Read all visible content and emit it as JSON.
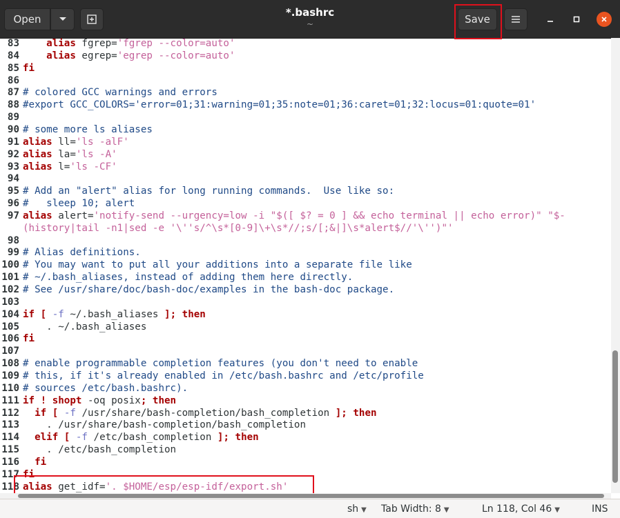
{
  "header": {
    "open_label": "Open",
    "open_dropdown_icon": "chevron-down-icon",
    "new_tab_icon": "new-document-icon",
    "title": "*.bashrc",
    "subtitle": "~",
    "save_label": "Save",
    "menu_icon": "hamburger-menu-icon",
    "minimize_icon": "minimize-icon",
    "maximize_icon": "maximize-icon",
    "close_icon": "close-icon"
  },
  "colors": {
    "keyword": "#a40000",
    "string": "#c4619a",
    "comment": "#204a87",
    "highlight_box": "#e0101c",
    "close_button": "#e95420"
  },
  "editor": {
    "lines": [
      {
        "n": "83",
        "segs": [
          [
            "    ",
            ""
          ],
          [
            "alias",
            "kw"
          ],
          [
            " fgrep=",
            ""
          ],
          [
            "'fgrep --color=auto'",
            "str"
          ]
        ]
      },
      {
        "n": "84",
        "segs": [
          [
            "    ",
            ""
          ],
          [
            "alias",
            "kw"
          ],
          [
            " egrep=",
            ""
          ],
          [
            "'egrep --color=auto'",
            "str"
          ]
        ]
      },
      {
        "n": "85",
        "segs": [
          [
            "fi",
            "kw"
          ]
        ]
      },
      {
        "n": "86",
        "segs": []
      },
      {
        "n": "87",
        "segs": [
          [
            "# colored GCC warnings and errors",
            "cmt"
          ]
        ]
      },
      {
        "n": "88",
        "segs": [
          [
            "#export GCC_COLORS='error=01;31:warning=01;35:note=01;36:caret=01;32:locus=01:quote=01'",
            "cmt"
          ]
        ]
      },
      {
        "n": "89",
        "segs": []
      },
      {
        "n": "90",
        "segs": [
          [
            "# some more ls aliases",
            "cmt"
          ]
        ]
      },
      {
        "n": "91",
        "segs": [
          [
            "alias",
            "kw"
          ],
          [
            " ll=",
            ""
          ],
          [
            "'ls -alF'",
            "str"
          ]
        ]
      },
      {
        "n": "92",
        "segs": [
          [
            "alias",
            "kw"
          ],
          [
            " la=",
            ""
          ],
          [
            "'ls -A'",
            "str"
          ]
        ]
      },
      {
        "n": "93",
        "segs": [
          [
            "alias",
            "kw"
          ],
          [
            " l=",
            ""
          ],
          [
            "'ls -CF'",
            "str"
          ]
        ]
      },
      {
        "n": "94",
        "segs": []
      },
      {
        "n": "95",
        "segs": [
          [
            "# Add an \"alert\" alias for long running commands.  Use like so:",
            "cmt"
          ]
        ]
      },
      {
        "n": "96",
        "segs": [
          [
            "#   sleep 10; alert",
            "cmt"
          ]
        ]
      },
      {
        "n": "97",
        "segs": [
          [
            "alias",
            "kw"
          ],
          [
            " alert=",
            ""
          ],
          [
            "'notify-send --urgency=low -i \"$([ $? = 0 ] && echo terminal || echo error)\" \"$-",
            "str"
          ]
        ]
      },
      {
        "n": "",
        "segs": [
          [
            "(history|tail -n1|sed -e '\\''s/^\\s*[0-9]\\+\\s*//;s/[;&|]\\s*alert$//'\\'')\"'",
            "str"
          ]
        ]
      },
      {
        "n": "98",
        "segs": []
      },
      {
        "n": "99",
        "segs": [
          [
            "# Alias definitions.",
            "cmt"
          ]
        ]
      },
      {
        "n": "100",
        "segs": [
          [
            "# You may want to put all your additions into a separate file like",
            "cmt"
          ]
        ]
      },
      {
        "n": "101",
        "segs": [
          [
            "# ~/.bash_aliases, instead of adding them here directly.",
            "cmt"
          ]
        ]
      },
      {
        "n": "102",
        "segs": [
          [
            "# See /usr/share/doc/bash-doc/examples in the bash-doc package.",
            "cmt"
          ]
        ]
      },
      {
        "n": "103",
        "segs": []
      },
      {
        "n": "104",
        "segs": [
          [
            "if [",
            "kw"
          ],
          [
            " ",
            ""
          ],
          [
            "-f",
            "opt"
          ],
          [
            " ~/.bash_aliases ",
            ""
          ],
          [
            "]; then",
            "kw"
          ]
        ]
      },
      {
        "n": "105",
        "segs": [
          [
            "    . ~/.bash_aliases",
            ""
          ]
        ]
      },
      {
        "n": "106",
        "segs": [
          [
            "fi",
            "kw"
          ]
        ]
      },
      {
        "n": "107",
        "segs": []
      },
      {
        "n": "108",
        "segs": [
          [
            "# enable programmable completion features (you don't need to enable",
            "cmt"
          ]
        ]
      },
      {
        "n": "109",
        "segs": [
          [
            "# this, if it's already enabled in /etc/bash.bashrc and /etc/profile",
            "cmt"
          ]
        ]
      },
      {
        "n": "110",
        "segs": [
          [
            "# sources /etc/bash.bashrc).",
            "cmt"
          ]
        ]
      },
      {
        "n": "111",
        "segs": [
          [
            "if ! shopt",
            "kw"
          ],
          [
            " -oq posix",
            ""
          ],
          [
            "; then",
            "kw"
          ]
        ]
      },
      {
        "n": "112",
        "segs": [
          [
            "  ",
            ""
          ],
          [
            "if [",
            "kw"
          ],
          [
            " ",
            ""
          ],
          [
            "-f",
            "opt"
          ],
          [
            " /usr/share/bash-completion/bash_completion ",
            ""
          ],
          [
            "]; then",
            "kw"
          ]
        ]
      },
      {
        "n": "113",
        "segs": [
          [
            "    . /usr/share/bash-completion/bash_completion",
            ""
          ]
        ]
      },
      {
        "n": "114",
        "segs": [
          [
            "  ",
            ""
          ],
          [
            "elif [",
            "kw"
          ],
          [
            " ",
            ""
          ],
          [
            "-f",
            "opt"
          ],
          [
            " /etc/bash_completion ",
            ""
          ],
          [
            "]; then",
            "kw"
          ]
        ]
      },
      {
        "n": "115",
        "segs": [
          [
            "    . /etc/bash_completion",
            ""
          ]
        ]
      },
      {
        "n": "116",
        "segs": [
          [
            "  ",
            ""
          ],
          [
            "fi",
            "kw"
          ]
        ]
      },
      {
        "n": "117",
        "segs": [
          [
            "fi",
            "kw"
          ]
        ]
      },
      {
        "n": "118",
        "segs": [
          [
            "alias",
            "kw"
          ],
          [
            " get_idf=",
            ""
          ],
          [
            "'. $HOME/esp/esp-idf/export.sh'",
            "str"
          ]
        ]
      }
    ]
  },
  "status": {
    "language": "sh",
    "tab_width": "Tab Width: 8",
    "cursor": "Ln 118, Col 46",
    "mode": "INS"
  }
}
